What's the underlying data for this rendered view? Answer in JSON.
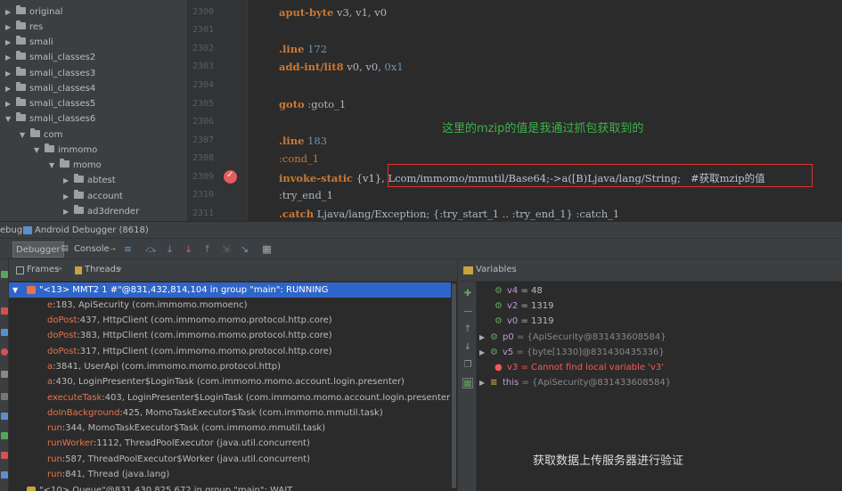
{
  "project_tree": [
    {
      "label": "original",
      "expanded": false
    },
    {
      "label": "res",
      "expanded": false
    },
    {
      "label": "smali",
      "expanded": false
    },
    {
      "label": "smali_classes2",
      "expanded": false
    },
    {
      "label": "smali_classes3",
      "expanded": false
    },
    {
      "label": "smali_classes4",
      "expanded": false
    },
    {
      "label": "smali_classes5",
      "expanded": false
    },
    {
      "label": "smali_classes6",
      "expanded": true
    },
    {
      "label": "com",
      "expanded": true
    },
    {
      "label": "immomo",
      "expanded": true
    },
    {
      "label": "momo",
      "expanded": true
    },
    {
      "label": "abtest",
      "expanded": false
    },
    {
      "label": "account",
      "expanded": false
    },
    {
      "label": "ad3drender",
      "expanded": false
    }
  ],
  "editor": {
    "line_numbers": [
      "2300",
      "2301",
      "2302",
      "2303",
      "2304",
      "2305",
      "2306",
      "2307",
      "2308",
      "2309",
      "2310",
      "2311"
    ],
    "breakpoint_line": "2309",
    "annotation_top": "这里的mzip的值是我通过抓包获取到的",
    "code": {
      "l0_op": "aput-byte",
      "l0_args": " v3, v1, v0",
      "l2_kw": ".line",
      "l2_num": " 172",
      "l3_op": "add-int/lit8",
      "l3_args": " v0, v0, ",
      "l3_num": "0x1",
      "l5_kw": "goto",
      "l5_label": " :goto_1",
      "l7_kw": ".line",
      "l7_num": " 183",
      "l8_label": ":cond_1",
      "l9_kw": "invoke-static",
      "l9_rest": " {v1}, Lcom/immomo/mmutil/Base64;->a([B)Ljava/lang/String;   #获取mzip的值",
      "l10_label": ":try_end_1",
      "l11_kw": ".catch",
      "l11_rest": " Ljava/lang/Exception; {:try_start_1 .. :try_end_1} :catch_1"
    }
  },
  "debug_window": {
    "title_prefix": "ebug",
    "title": "Android Debugger (8618)",
    "tab_debugger": "Debugger",
    "tab_console": "Console",
    "frames_label": "Frames",
    "threads_label": "Threads",
    "variables_label": "Variables"
  },
  "frames": {
    "current_thread": "\"<13> MMT2 1 #\"@831,432,814,104 in group \"main\": RUNNING",
    "rows": [
      {
        "method": "e",
        "detail": ":183, ApiSecurity (com.immomo.momoenc)"
      },
      {
        "method": "doPost",
        "detail": ":437, HttpClient (com.immomo.momo.protocol.http.core)"
      },
      {
        "method": "doPost",
        "detail": ":383, HttpClient (com.immomo.momo.protocol.http.core)"
      },
      {
        "method": "doPost",
        "detail": ":317, HttpClient (com.immomo.momo.protocol.http.core)"
      },
      {
        "method": "a",
        "detail": ":3841, UserApi (com.immomo.momo.protocol.http)"
      },
      {
        "method": "a",
        "detail": ":430, LoginPresenter$LoginTask (com.immomo.momo.account.login.presenter)"
      },
      {
        "method": "executeTask",
        "detail": ":403, LoginPresenter$LoginTask (com.immomo.momo.account.login.presenter)"
      },
      {
        "method": "doInBackground",
        "detail": ":425, MomoTaskExecutor$Task (com.immomo.mmutil.task)"
      },
      {
        "method": "run",
        "detail": ":344, MomoTaskExecutor$Task (com.immomo.mmutil.task)"
      },
      {
        "method": "runWorker",
        "detail": ":1112, ThreadPoolExecutor (java.util.concurrent)"
      },
      {
        "method": "run",
        "detail": ":587, ThreadPoolExecutor$Worker (java.util.concurrent)"
      },
      {
        "method": "run",
        "detail": ":841, Thread (java.lang)"
      }
    ],
    "partial_next_thread": "\"<10> Queue\"@831,430,825,672 in group \"main\": WAIT"
  },
  "variables": [
    {
      "name": "v4",
      "value": " = 48",
      "expandable": false,
      "kind": "local"
    },
    {
      "name": "v2",
      "value": " = 1319",
      "expandable": false,
      "kind": "local"
    },
    {
      "name": "v0",
      "value": " = 1319",
      "expandable": false,
      "kind": "local"
    },
    {
      "name": "p0",
      "value": " = {ApiSecurity@831433608584}",
      "expandable": true,
      "kind": "object"
    },
    {
      "name": "v5",
      "value": " = {byte[1330]@831430435336}",
      "expandable": true,
      "kind": "object"
    },
    {
      "name": "v3",
      "value": " = Cannot find local variable 'v3'",
      "expandable": false,
      "kind": "error"
    },
    {
      "name": "this",
      "value": " = {ApiSecurity@831433608584}",
      "expandable": true,
      "kind": "this"
    }
  ],
  "annotation_bottom": "获取数据上传服务器进行验证",
  "colors": {
    "accent_selection": "#2f65ca",
    "breakpoint_line": "#2d5ba8",
    "annotation_green": "#3db34a",
    "highlight_box": "#e03030"
  }
}
